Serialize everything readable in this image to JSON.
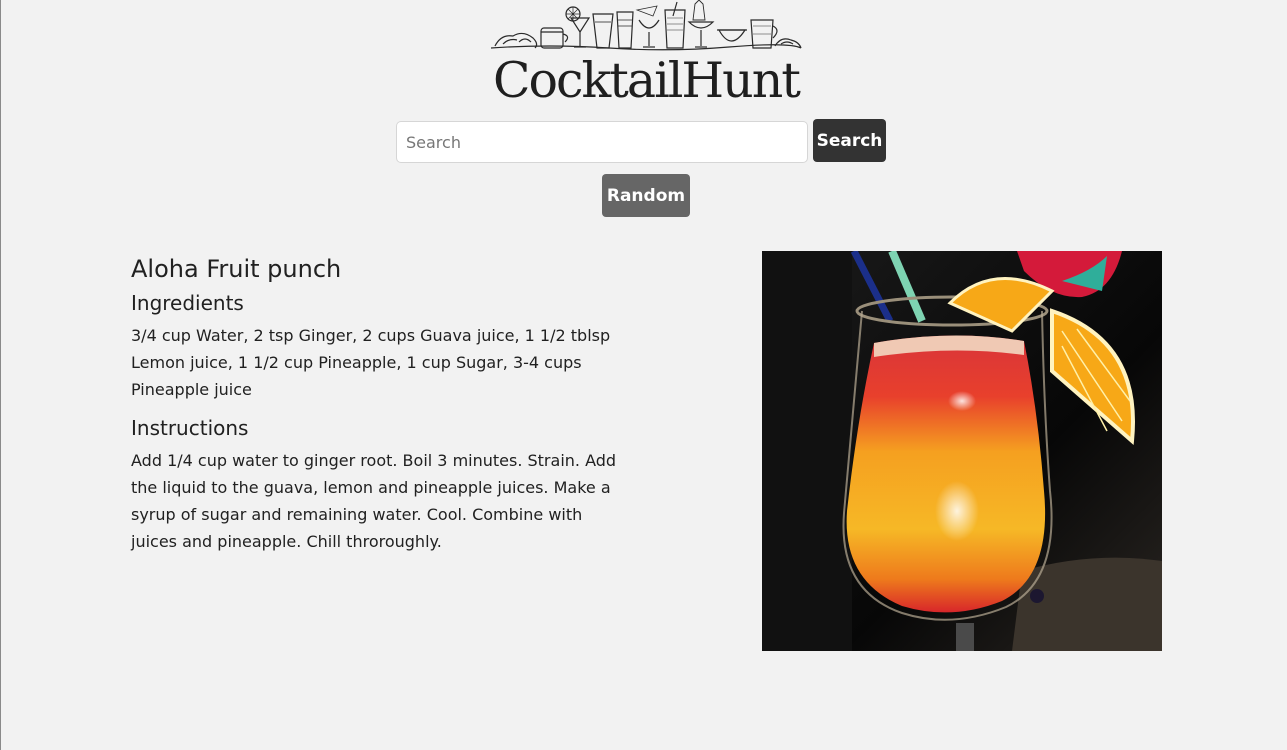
{
  "header": {
    "logo_text": "CocktailHunt",
    "illustration_icon": "cocktail-glasses-illustration"
  },
  "search": {
    "placeholder": "Search",
    "value": "",
    "button_label": "Search"
  },
  "random": {
    "button_label": "Random"
  },
  "drink": {
    "name": "Aloha Fruit punch",
    "ingredients_heading": "Ingredients",
    "ingredients_text": "3/4 cup Water, 2 tsp Ginger, 2 cups Guava juice, 1 1/2 tblsp Lemon juice, 1 1/2 cup Pineapple, 1 cup Sugar, 3-4 cups Pineapple juice",
    "instructions_heading": "Instructions",
    "instructions_text": "Add 1/4 cup water to ginger root. Boil 3 minutes. Strain. Add the liquid to the guava, lemon and pineapple juices. Make a syrup of sugar and remaining water. Cool. Combine with juices and pineapple. Chill throroughly.",
    "photo_icon": "tropical-cocktail-photo"
  },
  "colors": {
    "background": "#f2f2f2",
    "search_button": "#333333",
    "random_button": "#666666",
    "text": "#212121"
  }
}
